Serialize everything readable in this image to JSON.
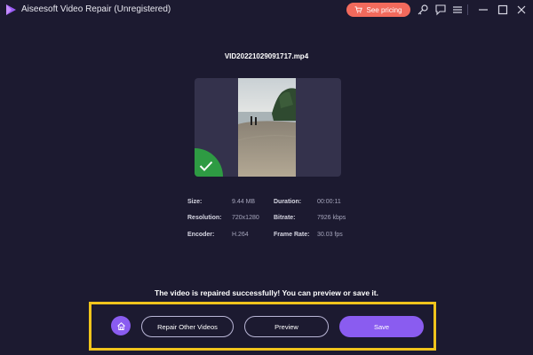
{
  "titlebar": {
    "app_title": "Aiseesoft Video Repair (Unregistered)",
    "pricing_label": "See pricing",
    "icons": [
      "cart-icon",
      "key-icon",
      "chat-icon",
      "menu-icon",
      "minimize-icon",
      "maximize-icon",
      "close-icon"
    ]
  },
  "video": {
    "filename": "VID20221029091717.mp4"
  },
  "details": {
    "size_label": "Size:",
    "size_value": "9.44 MB",
    "duration_label": "Duration:",
    "duration_value": "00:00:11",
    "resolution_label": "Resolution:",
    "resolution_value": "720x1280",
    "bitrate_label": "Bitrate:",
    "bitrate_value": "7926 kbps",
    "encoder_label": "Encoder:",
    "encoder_value": "H.264",
    "framerate_label": "Frame Rate:",
    "framerate_value": "30.03 fps"
  },
  "status": {
    "message": "The video is repaired successfully! You can preview or save it."
  },
  "actions": {
    "repair_other_label": "Repair Other Videos",
    "preview_label": "Preview",
    "save_label": "Save"
  },
  "colors": {
    "background": "#1c1a30",
    "accent": "#8a5cf0",
    "pricing": "#f26a5c",
    "success": "#2e9b43",
    "highlight": "#f0c41c"
  }
}
